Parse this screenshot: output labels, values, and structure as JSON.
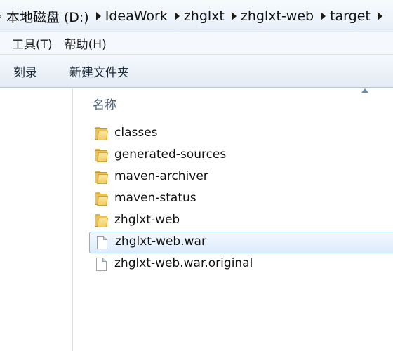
{
  "address_bar": {
    "edge_glyph": "‹",
    "breadcrumbs": [
      "本地磁盘 (D:)",
      "IdeaWork",
      "zhglxt",
      "zhglxt-web",
      "target"
    ]
  },
  "menu": {
    "items": [
      "工具(T)",
      "帮助(H)"
    ]
  },
  "toolbar": {
    "burn_label": "刻录",
    "new_folder_label": "新建文件夹"
  },
  "file_list": {
    "column_name_header": "名称",
    "items": [
      {
        "name": "classes",
        "type": "folder",
        "icon": "folder-icon"
      },
      {
        "name": "generated-sources",
        "type": "folder",
        "icon": "folder-icon"
      },
      {
        "name": "maven-archiver",
        "type": "folder",
        "icon": "folder-icon"
      },
      {
        "name": "maven-status",
        "type": "folder",
        "icon": "folder-icon"
      },
      {
        "name": "zhglxt-web",
        "type": "folder",
        "icon": "folder-icon"
      },
      {
        "name": "zhglxt-web.war",
        "type": "file",
        "icon": "file-icon",
        "selected": true
      },
      {
        "name": "zhglxt-web.war.original",
        "type": "file",
        "icon": "file-icon"
      }
    ]
  },
  "colors": {
    "selection_border": "#84acdd",
    "selection_fill": "#dcebfc",
    "header_text": "#4c607a"
  }
}
